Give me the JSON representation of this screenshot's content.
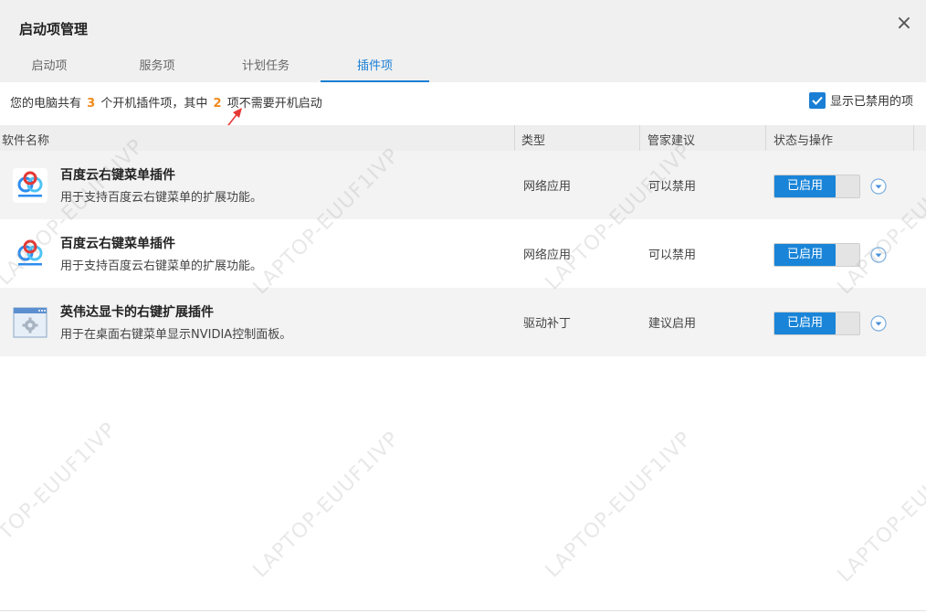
{
  "window": {
    "title": "启动项管理",
    "close_glyph": "×"
  },
  "tabs": [
    {
      "label": "启动项"
    },
    {
      "label": "服务项"
    },
    {
      "label": "计划任务"
    },
    {
      "label": "插件项"
    }
  ],
  "summary": {
    "prefix": "您的电脑共有",
    "total": "3",
    "middle": "个开机插件项，其中",
    "not_needed": "2",
    "suffix": "项不需要开机启动",
    "show_disabled_label": "显示已禁用的项",
    "show_disabled_checked": true
  },
  "table": {
    "headers": [
      "软件名称",
      "类型",
      "管家建议",
      "状态与操作"
    ],
    "rows": [
      {
        "name": "百度云右键菜单插件",
        "desc": "用于支持百度云右键菜单的扩展功能。",
        "type": "网络应用",
        "advice": "可以禁用",
        "status": "已启用",
        "icon": "baidu-cloud-icon"
      },
      {
        "name": "百度云右键菜单插件",
        "desc": "用于支持百度云右键菜单的扩展功能。",
        "type": "网络应用",
        "advice": "可以禁用",
        "status": "已启用",
        "icon": "baidu-cloud-icon"
      },
      {
        "name": "英伟达显卡的右键扩展插件",
        "desc": "用于在桌面右键菜单显示NVIDIA控制面板。",
        "type": "驱动补丁",
        "advice": "建议启用",
        "status": "已启用",
        "icon": "settings-window-icon"
      }
    ]
  },
  "watermark": "LAPTOP-EUUF1IVP",
  "colors": {
    "accent": "#1a7fd4",
    "highlight_number": "#f08a1c",
    "annotation_arrow": "#e53935"
  }
}
